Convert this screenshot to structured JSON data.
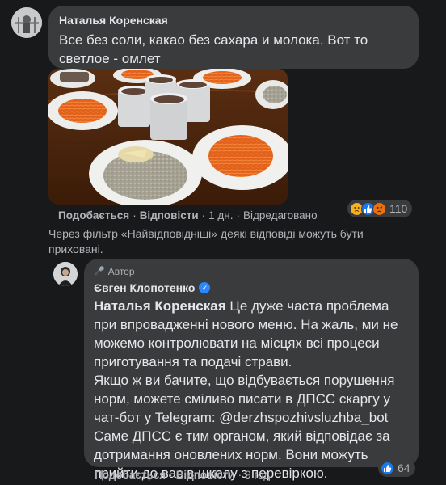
{
  "comment1": {
    "author": "Наталья Коренская",
    "text": "Все без соли, какао без сахара и молока. Вот то светлое - омлет",
    "actions": {
      "like": "Подобається",
      "reply": "Відповісти",
      "time": "1 дн.",
      "edited": "Відредаговано"
    },
    "reactions": {
      "icons": [
        "sad-icon",
        "like-icon",
        "angry-icon"
      ],
      "count": "110"
    }
  },
  "filter_note": "Через фільтр «Найвідповідніші» деякі відповіді можуть бути приховані.",
  "reply": {
    "badge": "Автор",
    "author": "Євген Клопотенко",
    "mention": "Наталья Коренская",
    "text": " Це дуже часта проблема при впровадженні нового меню. На жаль, ми не можемо контролювати на місцях всі процеси приготування та подачі страви.\nЯкщо ж ви бачите, що відбувається порушення норм, можете сміливо писати в ДПСС скаргу у чат-бот у Telegram: @derzhspozhivsluzhba_bot\nСаме ДПСС є тим органом, який відповідає за дотримання оновлених норм. Вони можуть прийти до вас в школу з перевіркою.",
    "actions": {
      "like": "Подобається",
      "reply": "Відповісти",
      "time": "9 год"
    },
    "reactions": {
      "icons": [
        "like-icon"
      ],
      "count": "64"
    }
  },
  "colors": {
    "background": "#18191a",
    "bubble": "#3a3b3c",
    "text_primary": "#e4e6eb",
    "text_secondary": "#b0b3b8",
    "accent": "#2d88ff"
  }
}
